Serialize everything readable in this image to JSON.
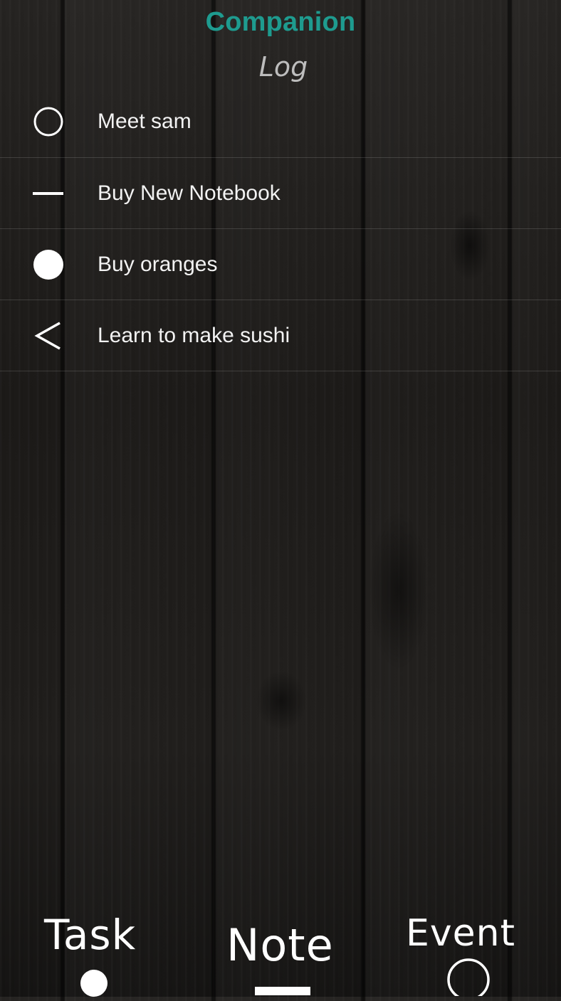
{
  "header": {
    "title": "Companion",
    "subtitle": "Log"
  },
  "log": {
    "items": [
      {
        "label": "Meet sam",
        "icon": "open-circle-icon"
      },
      {
        "label": "Buy New Notebook",
        "icon": "dash-icon"
      },
      {
        "label": "Buy oranges",
        "icon": "filled-circle-icon"
      },
      {
        "label": "Learn to make sushi",
        "icon": "less-than-icon"
      }
    ]
  },
  "bottom_nav": {
    "task_label": "Task",
    "note_label": "Note",
    "event_label": "Event"
  },
  "colors": {
    "accent": "#1e9b8f",
    "subtitle": "#bdbdbd",
    "text": "#f2f2f2",
    "background": "#1e1c1a"
  }
}
